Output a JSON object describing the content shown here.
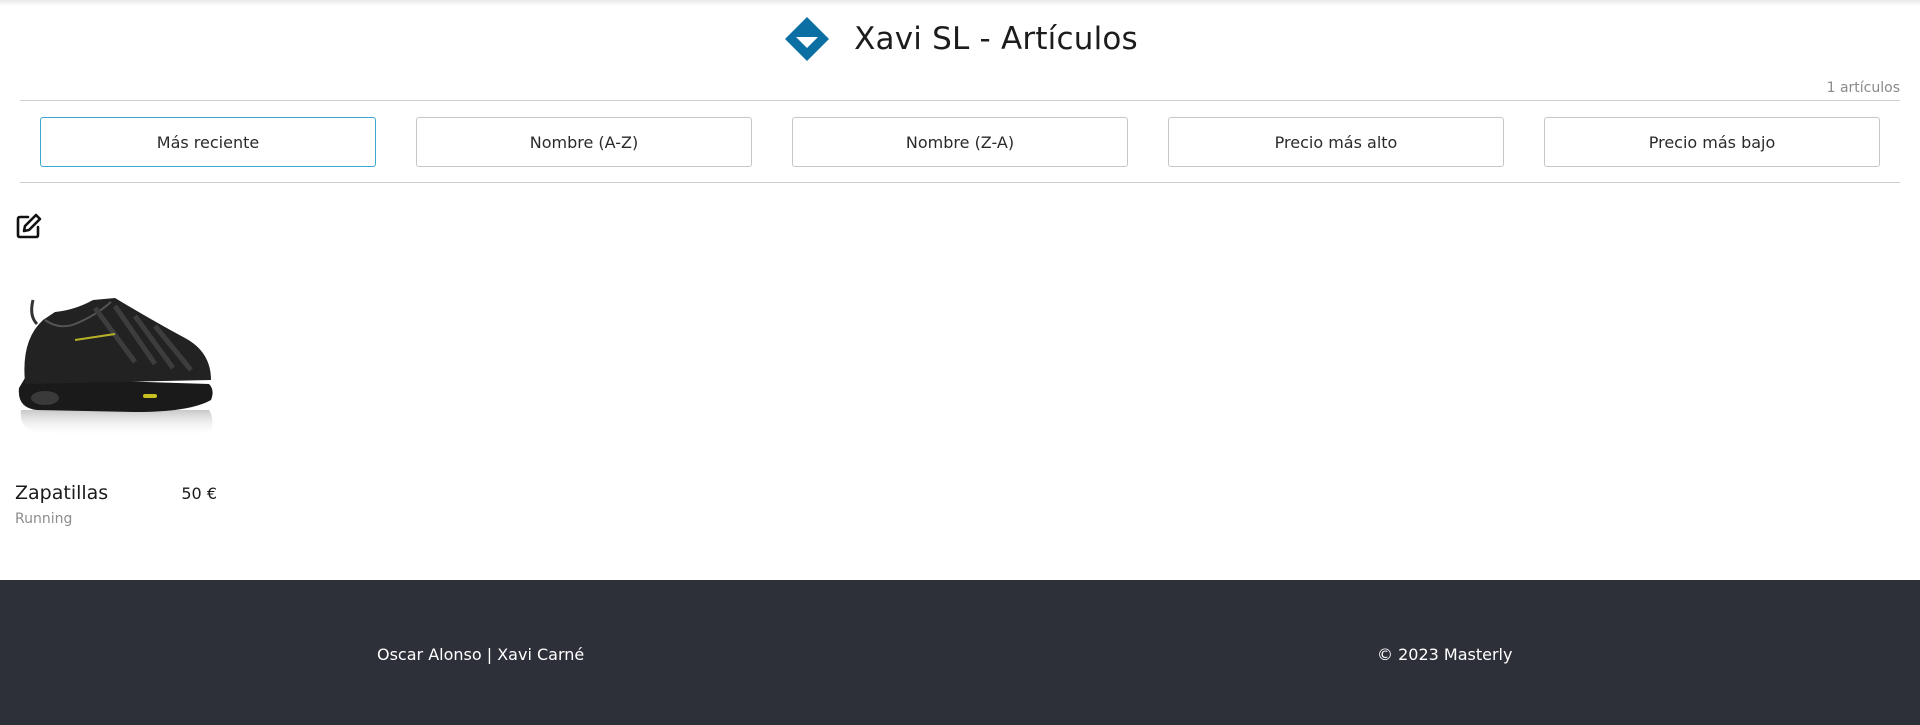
{
  "header": {
    "title": "Xavi SL - Artículos",
    "logo_icon": "diamond-logo-icon",
    "brand_color": "#0b6fa4"
  },
  "results": {
    "count_label": "1 artículos"
  },
  "sort_options": [
    {
      "label": "Más reciente",
      "active": true
    },
    {
      "label": "Nombre (A-Z)",
      "active": false
    },
    {
      "label": "Nombre (Z-A)",
      "active": false
    },
    {
      "label": "Precio más alto",
      "active": false
    },
    {
      "label": "Precio más bajo",
      "active": false
    }
  ],
  "toolbar": {
    "edit_icon": "edit-icon"
  },
  "products": [
    {
      "name": "Zapatillas",
      "price": "50 €",
      "category": "Running",
      "image_icon": "running-shoe-image"
    }
  ],
  "footer": {
    "authors": "Oscar Alonso | Xavi Carné",
    "copyright": "© 2023 Masterly",
    "background": "#2d3039"
  },
  "colors": {
    "active_border": "#3aa8cf",
    "button_border": "#c6c6c6"
  }
}
